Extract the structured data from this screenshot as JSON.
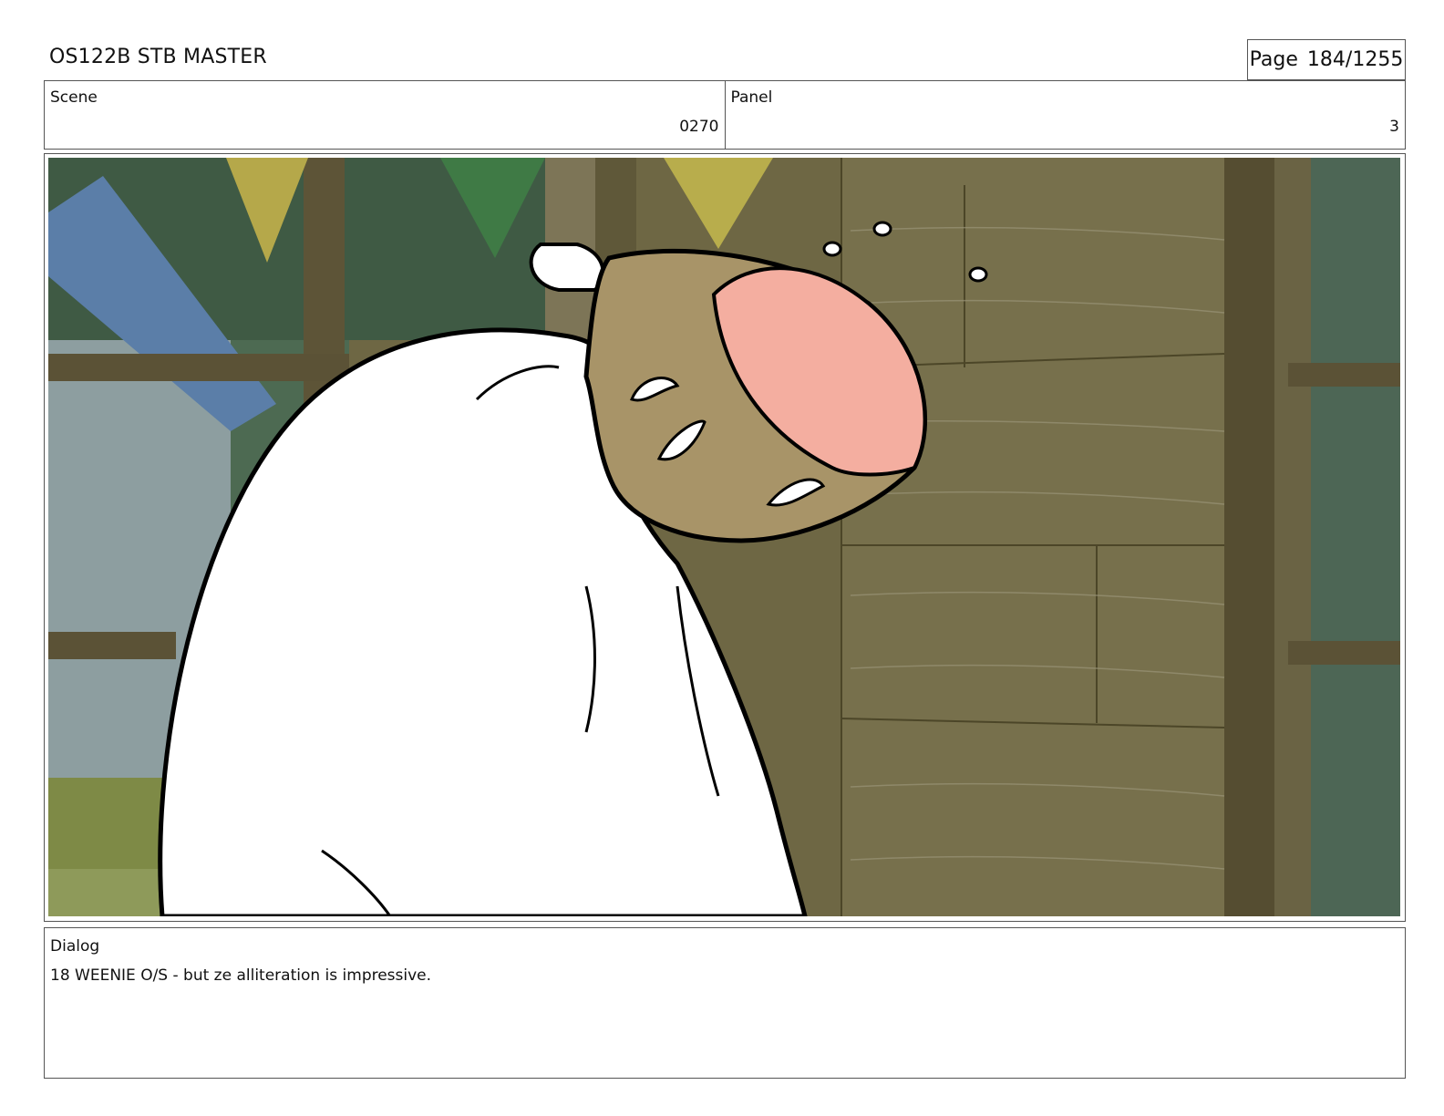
{
  "header": {
    "doc_title": "OS122B STB MASTER",
    "page_label": "Page",
    "page_number": "184/1255"
  },
  "scene": {
    "label": "Scene",
    "value": "0270"
  },
  "panel": {
    "label": "Panel",
    "value": "3"
  },
  "dialog": {
    "label": "Dialog",
    "text": "18 WEENIE O/S - but ze alliteration is impressive."
  },
  "colors": {
    "wood": "#6b6440",
    "wood_light": "#7b7350",
    "pine": "#3f5a44",
    "skin": "#a89468",
    "hair": "#f4aea0",
    "coat": "#ffffff"
  }
}
